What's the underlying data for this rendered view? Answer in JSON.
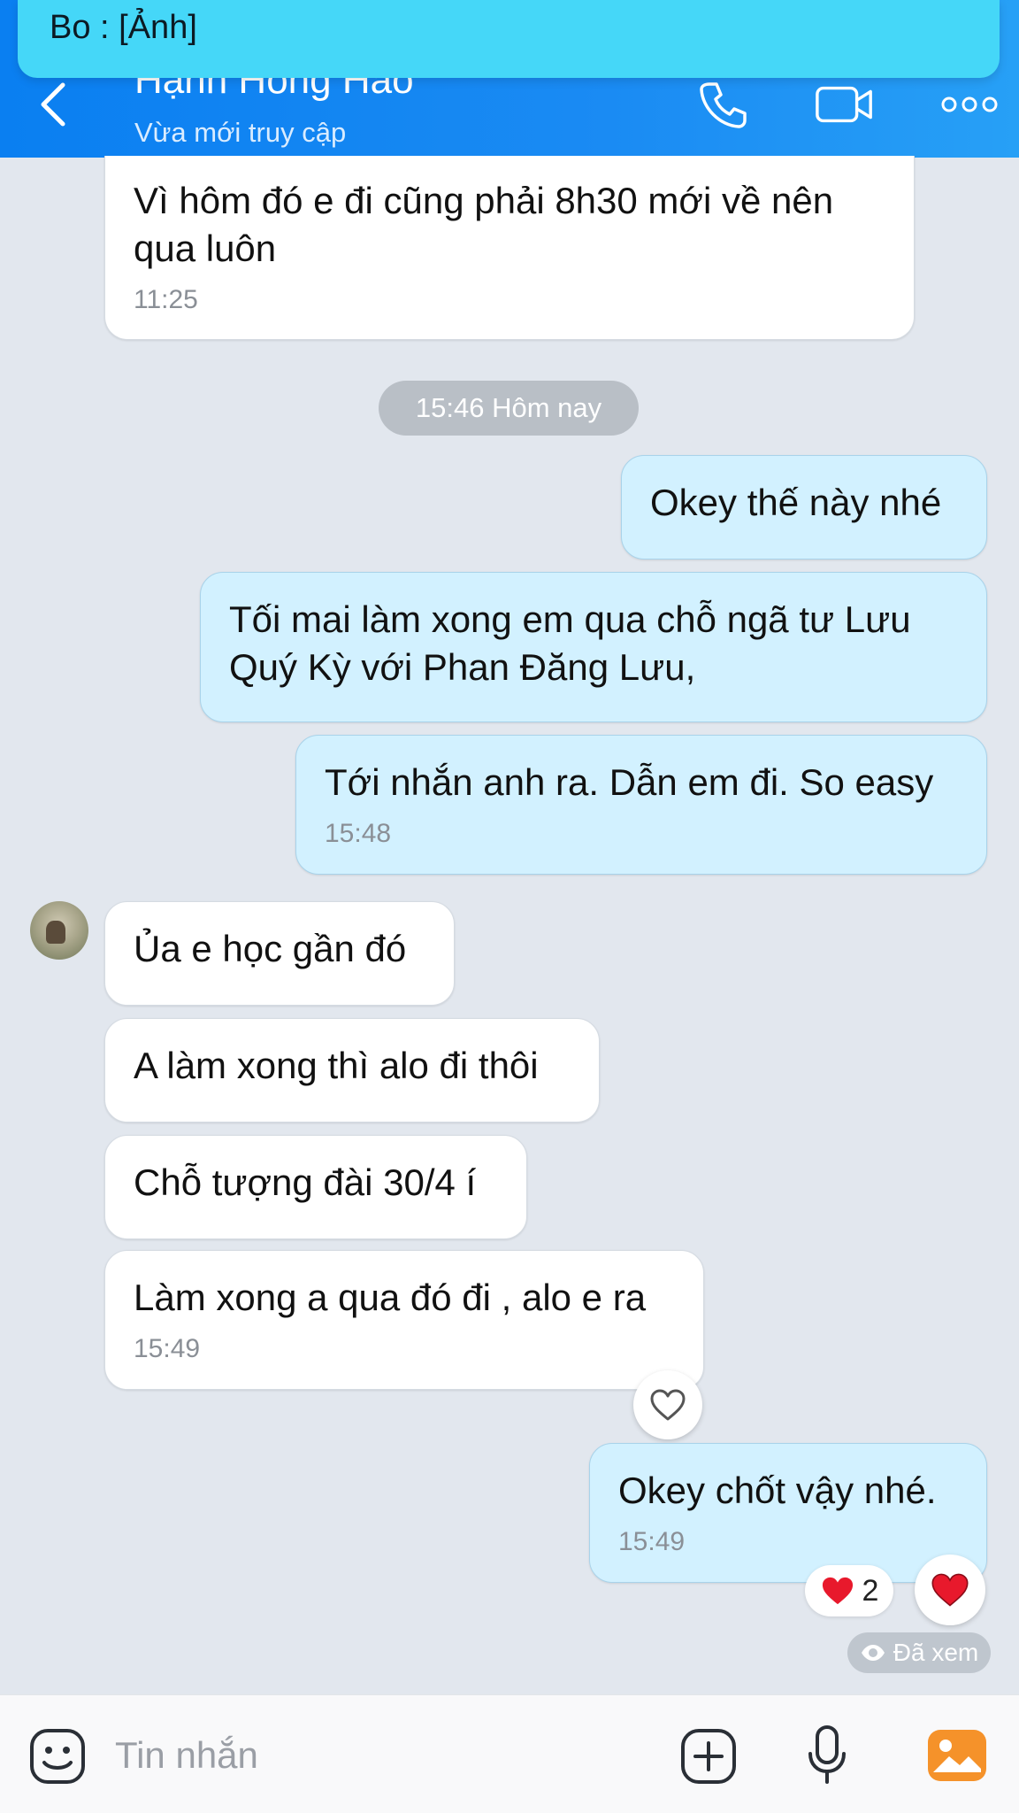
{
  "notification": {
    "text": "Bo : [Ảnh]"
  },
  "header": {
    "contact_name": "Hạnh Hồng Hảo",
    "status": "Vừa mới truy cập"
  },
  "date_divider": "15:46 Hôm nay",
  "messages": [
    {
      "direction": "in",
      "lines": [
        "Vì hôm đó e đi cũng phải 8h30 mới về nên",
        "qua luôn"
      ],
      "time": "11:25"
    },
    {
      "direction": "out",
      "lines": [
        "Okey thế này nhé"
      ],
      "time": ""
    },
    {
      "direction": "out",
      "lines": [
        "Tối mai làm xong em qua chỗ ngã tư Lưu",
        "Quý Kỳ với Phan Đăng Lưu,"
      ],
      "time": ""
    },
    {
      "direction": "out",
      "lines": [
        "Tới nhắn anh ra. Dẫn em đi. So easy"
      ],
      "time": "15:48"
    },
    {
      "direction": "in",
      "lines": [
        "Ủa e học gần đó"
      ],
      "time": ""
    },
    {
      "direction": "in",
      "lines": [
        "A làm xong thì alo đi thôi"
      ],
      "time": ""
    },
    {
      "direction": "in",
      "lines": [
        "Chỗ tượng đài 30/4 í"
      ],
      "time": ""
    },
    {
      "direction": "in",
      "lines": [
        "Làm xong a qua đó đi , alo e ra"
      ],
      "time": "15:49"
    },
    {
      "direction": "out",
      "lines": [
        "Okey chốt vậy nhé."
      ],
      "time": "15:49"
    }
  ],
  "reaction": {
    "count": "2",
    "color": "#e8192c"
  },
  "seen_label": "Đã xem",
  "composer": {
    "placeholder": "Tin nhắn"
  },
  "colors": {
    "header": "#0a7ff1",
    "outgoing_bubble": "#d2f1ff",
    "incoming_bubble": "#ffffff",
    "accent_orange": "#f5922a"
  }
}
